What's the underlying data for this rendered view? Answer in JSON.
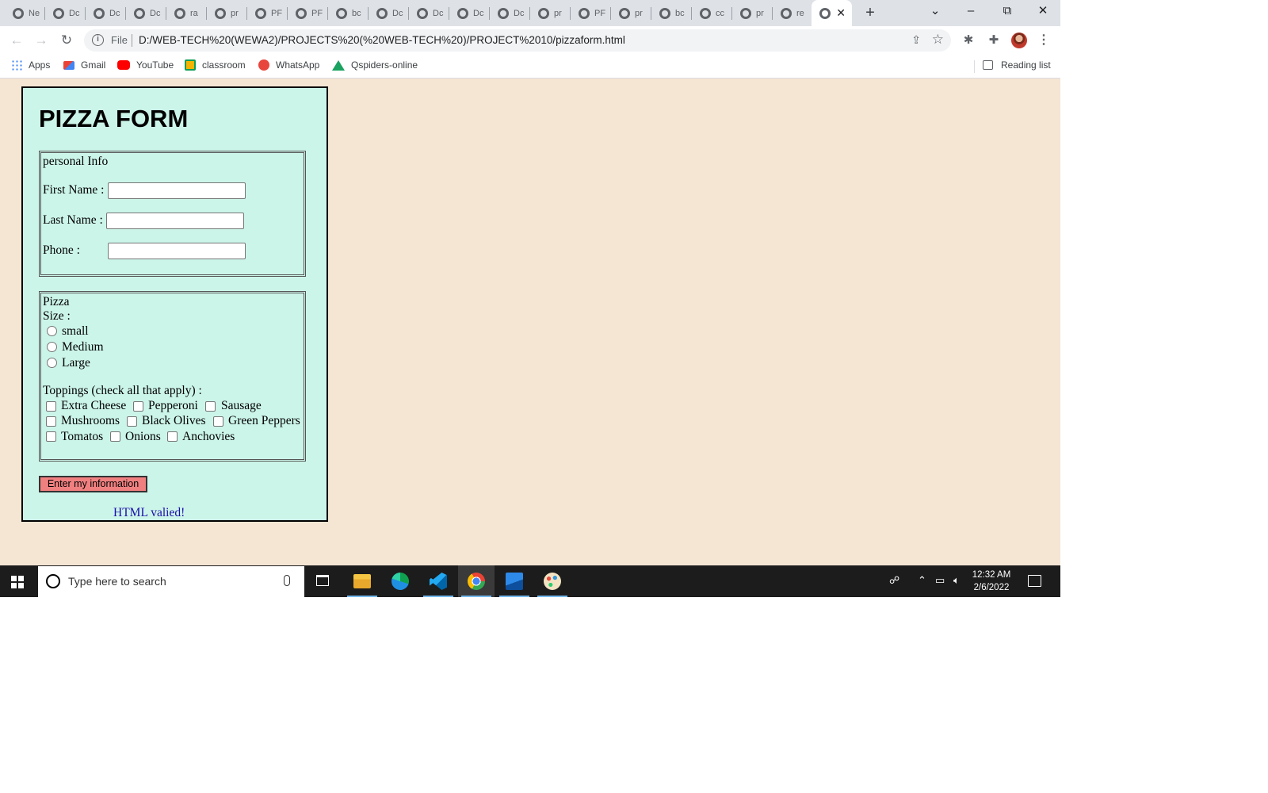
{
  "browser": {
    "tabs": [
      {
        "label": "Ne"
      },
      {
        "label": "Dc"
      },
      {
        "label": "Dc"
      },
      {
        "label": "Dc"
      },
      {
        "label": "ra"
      },
      {
        "label": "pr"
      },
      {
        "label": "PF"
      },
      {
        "label": "PF"
      },
      {
        "label": "bc"
      },
      {
        "label": "Dc"
      },
      {
        "label": "Dc"
      },
      {
        "label": "Dc"
      },
      {
        "label": "Dc"
      },
      {
        "label": "pr"
      },
      {
        "label": "PF"
      },
      {
        "label": "pr"
      },
      {
        "label": "bc"
      },
      {
        "label": "cc"
      },
      {
        "label": "pr"
      },
      {
        "label": "re"
      }
    ],
    "active_tab": {
      "label": ""
    },
    "new_tab_icon": "+",
    "window_controls": {
      "tab_search": "⌄",
      "minimize": "–",
      "restore": "⧉",
      "close": "✕"
    },
    "nav": {
      "back": "←",
      "forward": "→",
      "reload": "↻"
    },
    "address": {
      "scheme_label": "File",
      "url": "D:/WEB-TECH%20(WEWA2)/PROJECTS%20(%20WEB-TECH%20)/PROJECT%2010/pizzaform.html"
    },
    "bookmarks": [
      {
        "label": "Apps",
        "icon": "apps-grid-icon",
        "color": "#4285f4"
      },
      {
        "label": "Gmail",
        "icon": "gmail-icon",
        "color": "#ea4335"
      },
      {
        "label": "YouTube",
        "icon": "youtube-icon",
        "color": "#ff0000"
      },
      {
        "label": "classroom",
        "icon": "classroom-icon",
        "color": "#f4b400"
      },
      {
        "label": "WhatsApp",
        "icon": "whatsapp-icon",
        "color": "#e8453c"
      },
      {
        "label": "Qspiders-online",
        "icon": "qspiders-icon",
        "color": "#1aa260"
      }
    ],
    "reading_list": "Reading list"
  },
  "page": {
    "background": "#f5e5d3",
    "form_background": "#ccf5e9",
    "title": "PIZZA FORM",
    "personal": {
      "legend": "personal Info",
      "first_name_label": "First Name :",
      "first_name_value": "",
      "last_name_label": "Last Name :",
      "last_name_value": "",
      "phone_label": "Phone :",
      "phone_value": ""
    },
    "pizza": {
      "legend": "Pizza",
      "size_label": "Size :",
      "sizes": [
        {
          "label": "small",
          "checked": false
        },
        {
          "label": "Medium",
          "checked": false
        },
        {
          "label": "Large",
          "checked": false
        }
      ],
      "toppings_label": "Toppings (check all that apply) :",
      "toppings": [
        {
          "label": "Extra Cheese",
          "checked": false
        },
        {
          "label": "Pepperoni",
          "checked": false
        },
        {
          "label": "Sausage",
          "checked": false
        },
        {
          "label": "Mushrooms",
          "checked": false
        },
        {
          "label": "Black Olives",
          "checked": false
        },
        {
          "label": "Green Peppers",
          "checked": false
        },
        {
          "label": "Tomatos",
          "checked": false
        },
        {
          "label": "Onions",
          "checked": false
        },
        {
          "label": "Anchovies",
          "checked": false
        }
      ]
    },
    "submit_label": "Enter my information",
    "submit_color": "#f08080",
    "valid_link": "HTML valied!"
  },
  "taskbar": {
    "search_placeholder": "Type here to search",
    "apps": [
      {
        "name": "task-view-icon"
      },
      {
        "name": "file-explorer-icon"
      },
      {
        "name": "edge-icon"
      },
      {
        "name": "vscode-icon"
      },
      {
        "name": "chrome-icon"
      },
      {
        "name": "photos-icon"
      },
      {
        "name": "paint-icon"
      }
    ],
    "time": "12:32 AM",
    "date": "2/6/2022"
  }
}
